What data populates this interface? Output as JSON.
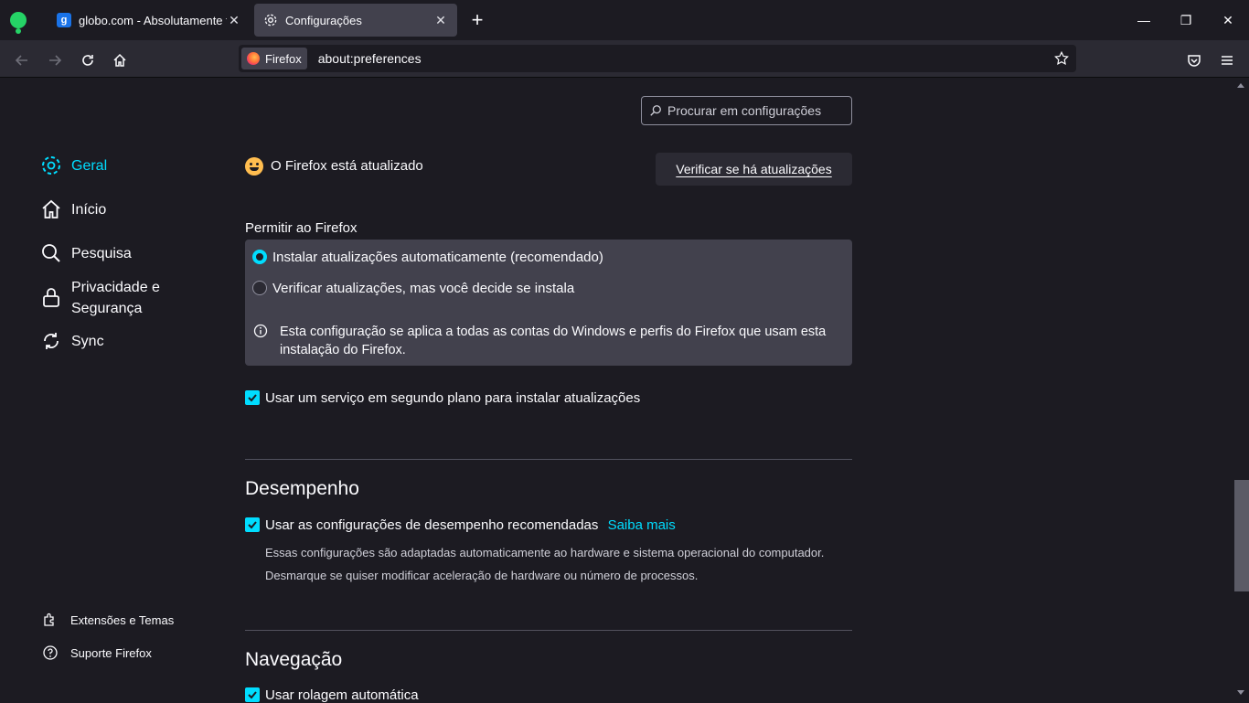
{
  "tabs": [
    {
      "title": "globo.com - Absolutamente tudo",
      "favicon": "g"
    },
    {
      "title": "Configurações"
    }
  ],
  "url": {
    "identity": "Firefox",
    "text": "about:preferences"
  },
  "search": {
    "placeholder": "Procurar em configurações"
  },
  "nav": {
    "items": [
      "Geral",
      "Início",
      "Pesquisa",
      "Privacidade e Segurança",
      "Sync"
    ],
    "footer": [
      "Extensões e Temas",
      "Suporte Firefox"
    ]
  },
  "update": {
    "status": "O Firefox está atualizado",
    "check_button": "Verificar se há atualizações",
    "allow_label": "Permitir ao Firefox",
    "option_auto": "Instalar atualizações automaticamente (recomendado)",
    "option_check": "Verificar atualizações, mas você decide se instala",
    "info": "Esta configuração se aplica a todas as contas do Windows e perfis do Firefox que usam esta instalação do Firefox.",
    "background_service": "Usar um serviço em segundo plano para instalar atualizações"
  },
  "performance": {
    "heading": "Desempenho",
    "recommended": "Usar as configurações de desempenho recomendadas",
    "learn_more": "Saiba mais",
    "desc1": "Essas configurações são adaptadas automaticamente ao hardware e sistema operacional do computador.",
    "desc2": "Desmarque se quiser modificar aceleração de hardware ou número de processos."
  },
  "navigation": {
    "heading": "Navegação",
    "autoscroll": "Usar rolagem automática"
  },
  "colors": {
    "accent": "#00ddff",
    "background": "#1c1b22",
    "panel": "#42414d"
  }
}
